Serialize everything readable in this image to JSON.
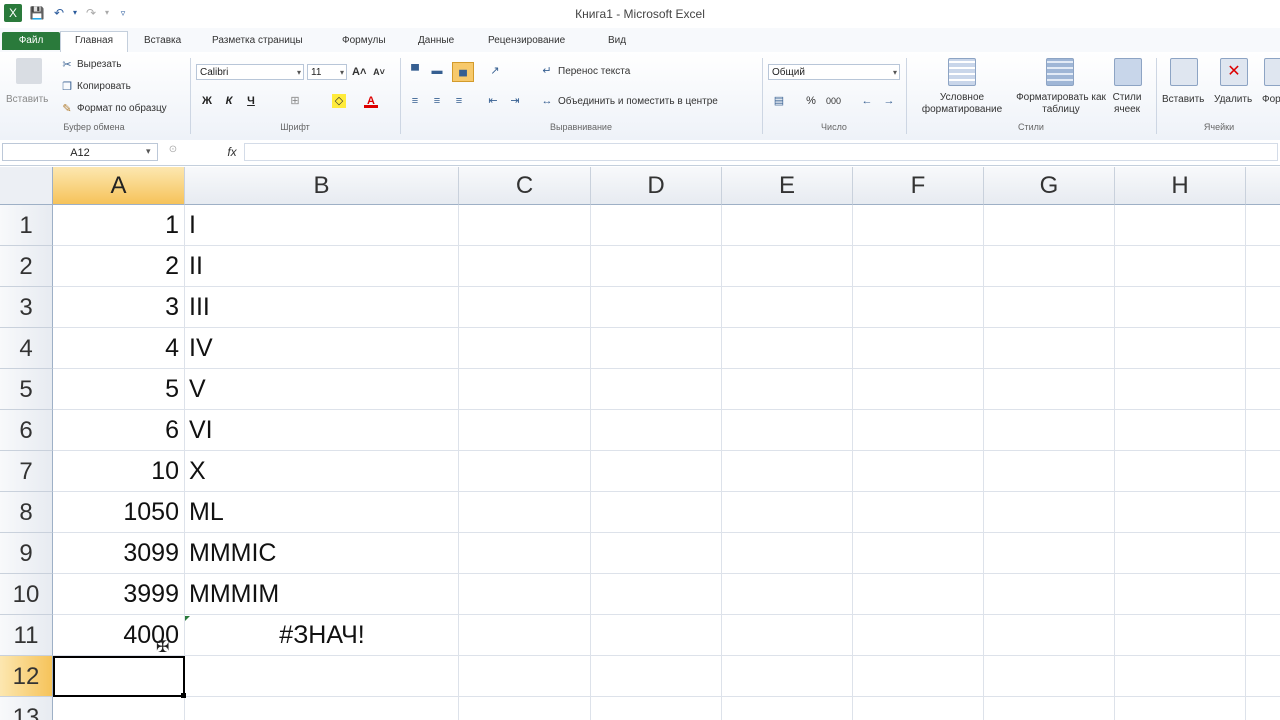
{
  "window": {
    "title": "Книга1  -  Microsoft Excel"
  },
  "ribbon": {
    "tabs": [
      "Файл",
      "Главная",
      "Вставка",
      "Разметка страницы",
      "Формулы",
      "Данные",
      "Рецензирование",
      "Вид"
    ],
    "clipboard": {
      "paste": "Вставить",
      "cut": "Вырезать",
      "copy": "Копировать",
      "format_painter": "Формат по образцу",
      "group": "Буфер обмена"
    },
    "font": {
      "name": "Calibri",
      "size": "11",
      "bold": "Ж",
      "italic": "К",
      "underline": "Ч",
      "group": "Шрифт"
    },
    "alignment": {
      "wrap": "Перенос текста",
      "merge": "Объединить и поместить в центре",
      "group": "Выравнивание"
    },
    "number": {
      "format": "Общий",
      "percent": "%",
      "thousands": "000",
      "group": "Число"
    },
    "styles": {
      "conditional": "Условное форматирование",
      "as_table": "Форматировать как таблицу",
      "cell_styles": "Стили ячеек",
      "group": "Стили"
    },
    "cells": {
      "insert": "Вставить",
      "delete": "Удалить",
      "format": "Фор",
      "group": "Ячейки"
    }
  },
  "formula_bar": {
    "name_box": "A12",
    "fx": "fx",
    "value": ""
  },
  "sheet": {
    "columns": [
      "A",
      "B",
      "C",
      "D",
      "E",
      "F",
      "G",
      "H"
    ],
    "rows": [
      {
        "n": "1",
        "a": "1",
        "b": "I"
      },
      {
        "n": "2",
        "a": "2",
        "b": "II"
      },
      {
        "n": "3",
        "a": "3",
        "b": "III"
      },
      {
        "n": "4",
        "a": "4",
        "b": "IV"
      },
      {
        "n": "5",
        "a": "5",
        "b": "V"
      },
      {
        "n": "6",
        "a": "6",
        "b": "VI"
      },
      {
        "n": "7",
        "a": "10",
        "b": "X"
      },
      {
        "n": "8",
        "a": "1050",
        "b": "ML"
      },
      {
        "n": "9",
        "a": "3099",
        "b": "MMMIC"
      },
      {
        "n": "10",
        "a": "3999",
        "b": "MMMIM"
      },
      {
        "n": "11",
        "a": "4000",
        "b": "#ЗНАЧ!"
      },
      {
        "n": "12",
        "a": "",
        "b": ""
      },
      {
        "n": "13",
        "a": "",
        "b": ""
      }
    ],
    "active_cell": "A12"
  }
}
